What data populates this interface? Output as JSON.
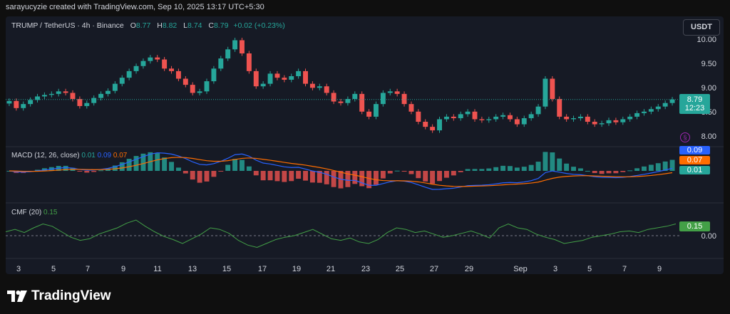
{
  "attribution": "sarayucyzie created with TradingView.com, Sep 10, 2025 13:17 UTC+5:30",
  "symbol": {
    "name": "TRUMP / TetherUS · 4h · Binance",
    "open_key": "O",
    "open": "8.77",
    "high_key": "H",
    "high": "8.82",
    "low_key": "L",
    "low": "8.74",
    "close_key": "C",
    "close": "8.79",
    "change": "+0.02 (+0.23%)"
  },
  "currency_button": "USDT",
  "price_axis": [
    "10.00",
    "9.50",
    "9.00",
    "8.50",
    "8.00"
  ],
  "last_price": {
    "value": "8.79",
    "countdown": "12:23"
  },
  "macd": {
    "label": "MACD (12, 26, close)",
    "val1": "0.01",
    "val2": "0.09",
    "val3": "0.07",
    "tags": [
      "0.09",
      "0.07",
      "0.01"
    ]
  },
  "cmf": {
    "label": "CMF (20)",
    "value": "0.15",
    "tag": "0.15",
    "zero_label": "0.00"
  },
  "dates": [
    "3",
    "5",
    "7",
    "9",
    "11",
    "13",
    "15",
    "17",
    "19",
    "21",
    "23",
    "25",
    "27",
    "29",
    "Sep",
    "3",
    "5",
    "7",
    "9"
  ],
  "brand": "TradingView",
  "colors": {
    "up": "#26a69a",
    "down": "#ef5350",
    "macd_line": "#2962ff",
    "signal_line": "#ff6d00",
    "cmf_line": "#43a047",
    "background": "#161a25"
  },
  "chart_data": {
    "type": "line",
    "price_close_series": [
      8.76,
      8.62,
      8.7,
      8.78,
      8.85,
      8.88,
      8.9,
      8.95,
      8.92,
      8.8,
      8.66,
      8.72,
      8.82,
      8.9,
      8.96,
      9.1,
      9.22,
      9.35,
      9.45,
      9.55,
      9.62,
      9.58,
      9.4,
      9.35,
      9.2,
      9.08,
      8.92,
      8.95,
      9.15,
      9.4,
      9.6,
      9.78,
      9.96,
      9.7,
      9.35,
      9.05,
      9.1,
      9.3,
      9.22,
      9.18,
      9.25,
      9.35,
      9.1,
      9.02,
      9.05,
      8.92,
      8.75,
      8.72,
      8.8,
      8.9,
      8.55,
      8.45,
      8.7,
      8.92,
      8.95,
      8.9,
      8.7,
      8.55,
      8.35,
      8.25,
      8.18,
      8.4,
      8.45,
      8.42,
      8.5,
      8.55,
      8.4,
      8.38,
      8.4,
      8.45,
      8.48,
      8.4,
      8.3,
      8.42,
      8.5,
      8.65,
      9.2,
      8.8,
      8.45,
      8.4,
      8.42,
      8.45,
      8.35,
      8.3,
      8.32,
      8.38,
      8.34,
      8.4,
      8.45,
      8.52,
      8.55,
      8.6,
      8.65,
      8.72,
      8.79
    ],
    "price_axis_ticks": [
      10.0,
      9.5,
      9.0,
      8.5,
      8.0
    ],
    "cmf_series": [
      0.05,
      0.08,
      0.04,
      0.1,
      0.15,
      0.12,
      0.05,
      -0.02,
      -0.06,
      -0.04,
      0.02,
      0.06,
      0.1,
      0.16,
      0.2,
      0.12,
      0.05,
      -0.01,
      -0.05,
      -0.1,
      -0.04,
      0.02,
      0.1,
      0.08,
      0.03,
      -0.06,
      -0.12,
      -0.15,
      -0.1,
      -0.05,
      -0.02,
      0.0,
      0.04,
      0.08,
      0.02,
      -0.04,
      -0.06,
      -0.03,
      -0.08,
      -0.1,
      -0.05,
      0.04,
      0.1,
      0.08,
      0.04,
      0.06,
      0.02,
      -0.02,
      0.0,
      0.03,
      0.06,
      0.02,
      -0.03,
      0.1,
      0.15,
      0.1,
      0.08,
      0.02,
      -0.02,
      -0.05,
      -0.1,
      -0.08,
      -0.06,
      -0.02,
      0.0,
      0.02,
      0.05,
      0.06,
      0.04,
      0.08,
      0.1,
      0.12,
      0.15
    ],
    "cmf_axis_ticks": [
      0.15,
      0.0
    ],
    "x_tick_labels": [
      "3",
      "5",
      "7",
      "9",
      "11",
      "13",
      "15",
      "17",
      "19",
      "21",
      "23",
      "25",
      "27",
      "29",
      "Sep",
      "3",
      "5",
      "7",
      "9"
    ]
  }
}
